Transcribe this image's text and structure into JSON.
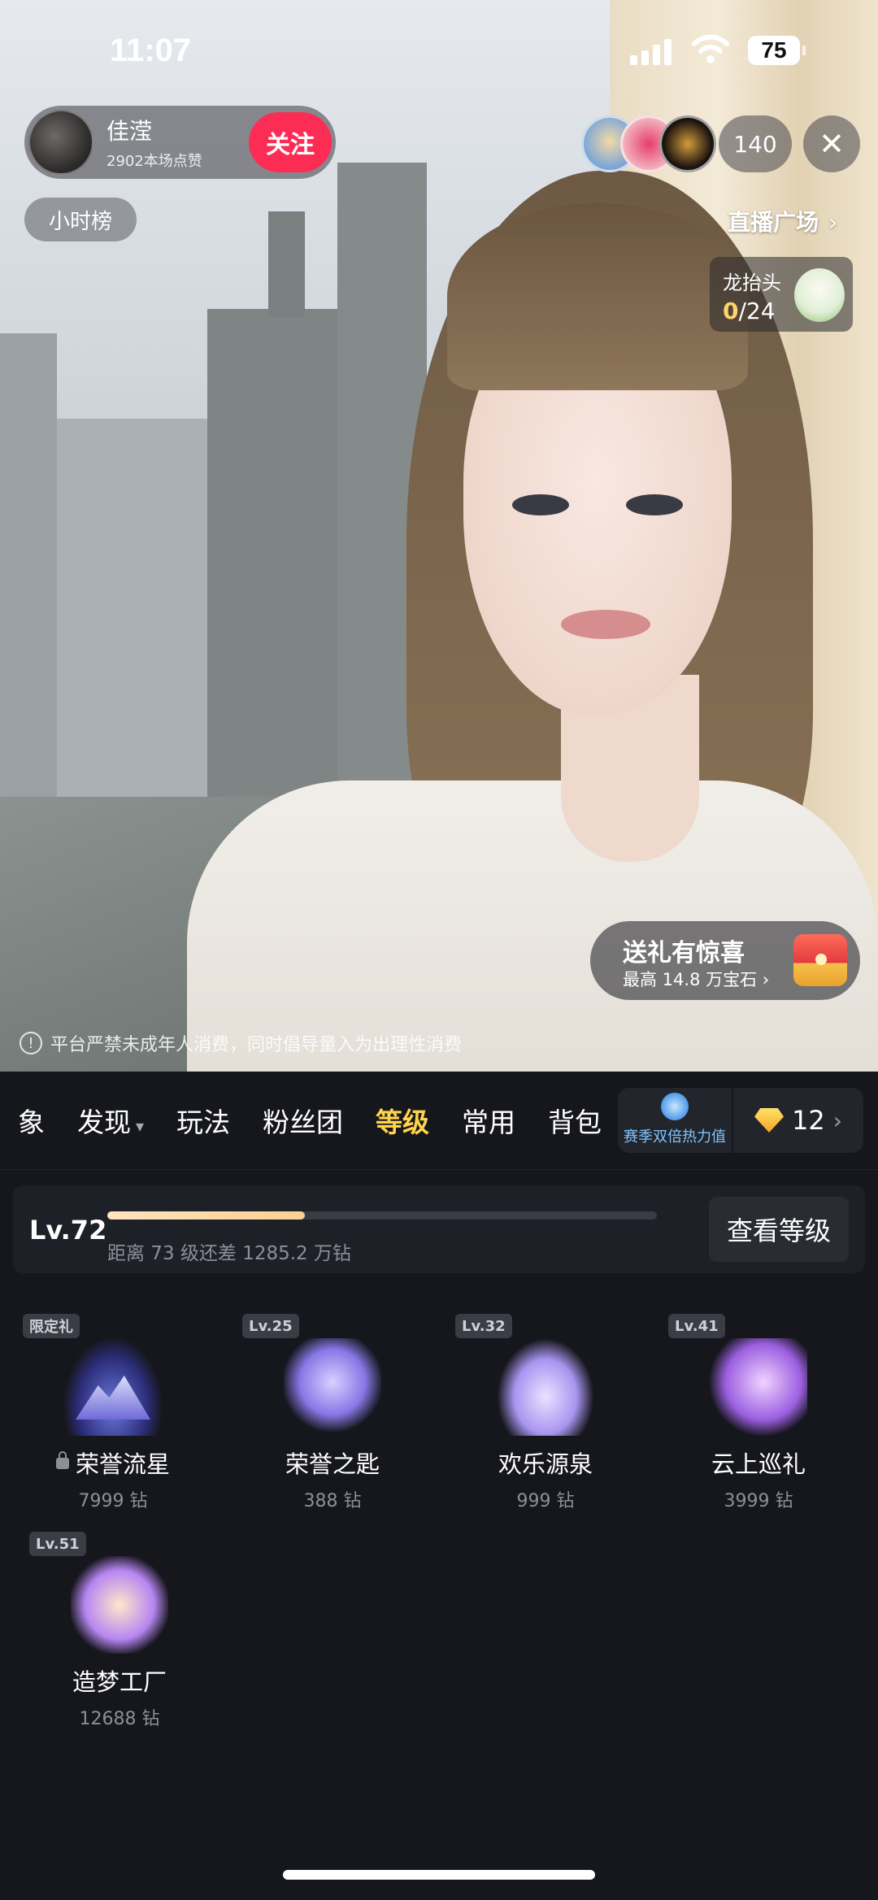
{
  "status_bar": {
    "time": "11:07",
    "battery": "75"
  },
  "host": {
    "name": "佳滢",
    "likes": "2902本场点赞",
    "follow_label": "关注"
  },
  "hourly_rank": "小时榜",
  "viewers": {
    "count": "140"
  },
  "live_plaza": {
    "label": "直播广场",
    "arrow": "›"
  },
  "task": {
    "title": "龙抬头",
    "current": "0",
    "total": "/24"
  },
  "gift_promo": {
    "title": "送礼有惊喜",
    "subtitle": "最高 14.8 万宝石 ›"
  },
  "notice": "平台严禁未成年人消费，同时倡导量入为出理性消费",
  "panel": {
    "tabs": [
      {
        "label": "象"
      },
      {
        "label": "发现",
        "caret": "▾"
      },
      {
        "label": "玩法"
      },
      {
        "label": "粉丝团"
      },
      {
        "label": "等级",
        "active": true
      },
      {
        "label": "常用"
      },
      {
        "label": "背包"
      }
    ],
    "season_label": "赛季双倍热力值",
    "diamond_balance": "12",
    "level": {
      "current": "Lv.72",
      "progress": 0.36,
      "hint": "距离 73 级还差 1285.2 万钻",
      "button": "查看等级"
    },
    "gifts": [
      {
        "tag": "限定礼",
        "name": "荣誉流星",
        "price": "7999 钻",
        "locked": true,
        "icon": "meteor-icon"
      },
      {
        "tag": "Lv.25",
        "name": "荣誉之匙",
        "price": "388 钻",
        "locked": false,
        "icon": "key-icon"
      },
      {
        "tag": "Lv.32",
        "name": "欢乐源泉",
        "price": "999 钻",
        "locked": false,
        "icon": "fountain-icon"
      },
      {
        "tag": "Lv.41",
        "name": "云上巡礼",
        "price": "3999 钻",
        "locked": false,
        "icon": "cloud-castle-icon"
      },
      {
        "tag": "Lv.51",
        "name": "造梦工厂",
        "price": "12688 钻",
        "locked": false,
        "icon": "dream-factory-icon"
      }
    ]
  },
  "colors": {
    "accent_pink": "#fd2c55",
    "active_tab": "#ffd44c",
    "panel_bg": "#16171d"
  }
}
